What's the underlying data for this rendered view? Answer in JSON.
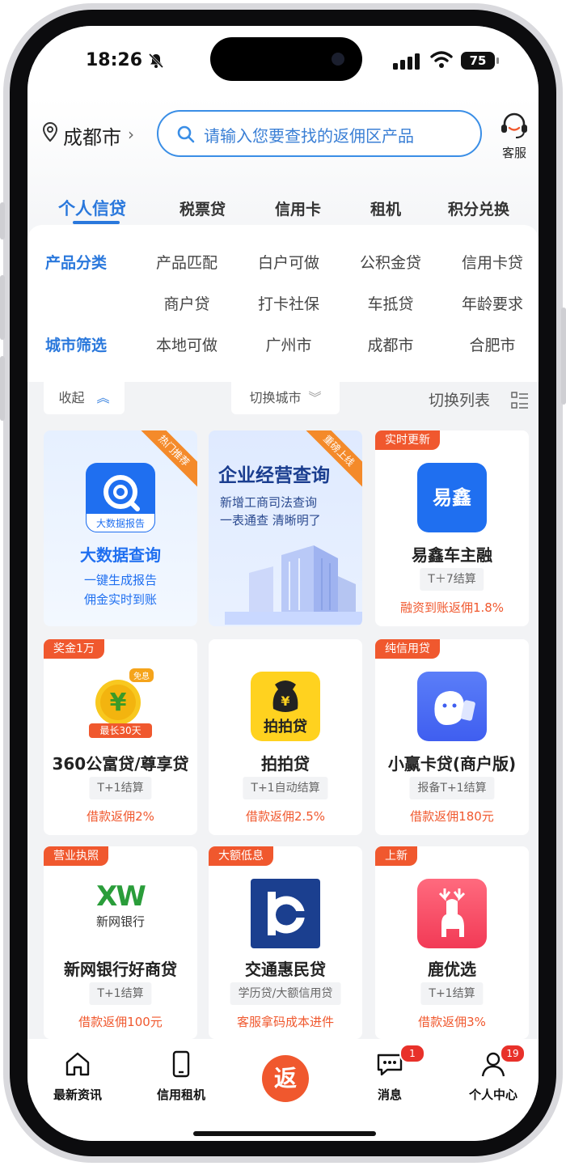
{
  "status": {
    "time": "18:26",
    "battery": "75"
  },
  "header": {
    "city": "成都市",
    "search_placeholder": "请输入您要查找的返佣区产品",
    "service_label": "客服"
  },
  "tabs": [
    "个人信贷",
    "税票贷",
    "信用卡",
    "租机",
    "积分兑换"
  ],
  "filter": {
    "category_label": "产品分类",
    "categories_row1": [
      "产品匹配",
      "白户可做",
      "公积金贷",
      "信用卡贷"
    ],
    "categories_row2": [
      "商户贷",
      "打卡社保",
      "车抵贷",
      "年龄要求"
    ],
    "city_label": "城市筛选",
    "cities": [
      "本地可做",
      "广州市",
      "成都市",
      "合肥市"
    ],
    "collapse_label": "收起",
    "switch_city_label": "切换城市",
    "switch_list_label": "切换列表"
  },
  "promo": {
    "bigdata": {
      "ribbon": "热门推荐",
      "logo_caption": "大数据报告",
      "title": "大数据查询",
      "line1": "一键生成报告",
      "line2": "佣金实时到账"
    },
    "enterprise": {
      "ribbon": "重磅上线",
      "title": "企业经营查询",
      "line1": "新增工商司法查询",
      "line2": "一表通查  清晰明了"
    }
  },
  "products": [
    {
      "tag": "实时更新",
      "logo_text": "易鑫",
      "title": "易鑫车主融",
      "settle": "T＋7结算",
      "fee": "融资到账返佣1.8%",
      "color": "#1f6ff0"
    },
    {
      "tag": "奖金1万",
      "logo_text": "最长30天",
      "logo_badge": "免息",
      "title": "360公富贷/尊享贷",
      "settle": "T+1结算",
      "fee": "借款返佣2%",
      "color": "#f5a41b"
    },
    {
      "tag": "",
      "logo_text": "拍拍贷",
      "title": "拍拍贷",
      "settle": "T+1自动结算",
      "fee": "借款返佣2.5%",
      "color": "#ffd21f"
    },
    {
      "tag": "纯信用贷",
      "logo_text": "",
      "title": "小赢卡贷(商户版)",
      "settle": "报备T+1结算",
      "fee": "借款返佣180元",
      "color": "#4a6cf5"
    },
    {
      "tag": "营业执照",
      "logo_text": "XW",
      "logo_sub": "新网银行",
      "title": "新网银行好商贷",
      "settle": "T+1结算",
      "fee": "借款返佣100元",
      "color": "#2a9d3a"
    },
    {
      "tag": "大额低息",
      "logo_text": "",
      "title": "交通惠民贷",
      "settle": "学历贷/大额信用贷",
      "fee": "客服拿码成本进件",
      "color": "#1b3f8f"
    },
    {
      "tag": "上新",
      "logo_text": "",
      "title": "鹿优选",
      "settle": "T+1结算",
      "fee": "借款返佣3%",
      "color": "#f5455e"
    }
  ],
  "bottom_nav": [
    {
      "label": "最新资讯"
    },
    {
      "label": "信用租机"
    },
    {
      "label": "",
      "center": "返"
    },
    {
      "label": "消息",
      "badge": "1"
    },
    {
      "label": "个人中心",
      "badge": "19"
    }
  ]
}
